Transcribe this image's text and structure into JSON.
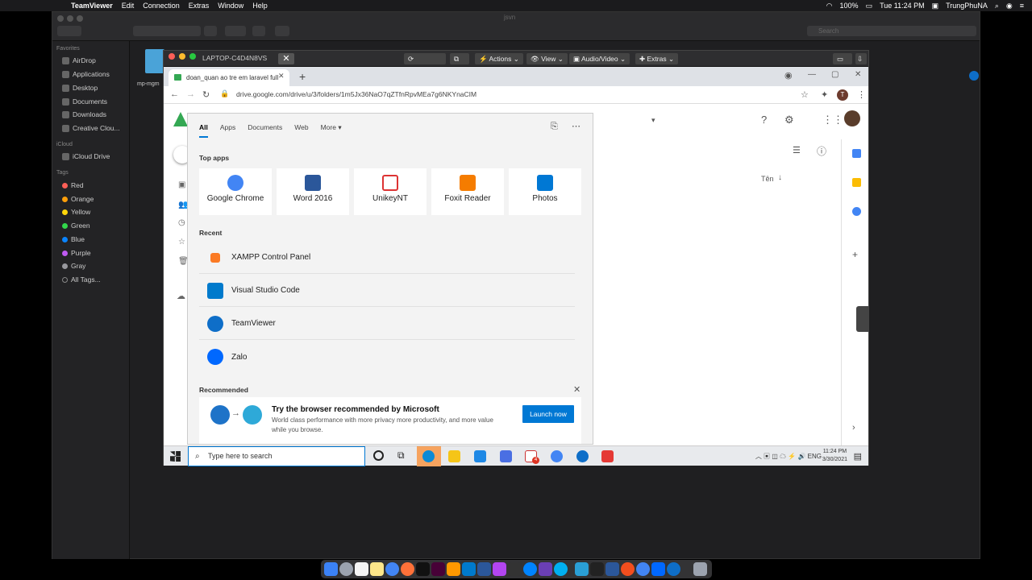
{
  "mac_menubar": {
    "app_name": "TeamViewer",
    "menus": [
      "Edit",
      "Connection",
      "Extras",
      "Window",
      "Help"
    ],
    "battery": "100%",
    "clock": "Tue 11:24 PM",
    "user": "TrungPhuNA"
  },
  "finder": {
    "title": "jsvn",
    "search_placeholder": "Search",
    "favorites_label": "Favorites",
    "favorites": [
      "AirDrop",
      "Applications",
      "Desktop",
      "Documents",
      "Downloads",
      "Creative Clou..."
    ],
    "icloud_label": "iCloud",
    "icloud_items": [
      "iCloud Drive"
    ],
    "tags_label": "Tags",
    "tags": [
      {
        "name": "Red",
        "color": "#ff5f57"
      },
      {
        "name": "Orange",
        "color": "#ff9f0a"
      },
      {
        "name": "Yellow",
        "color": "#ffd60a"
      },
      {
        "name": "Green",
        "color": "#32d74b"
      },
      {
        "name": "Blue",
        "color": "#0a84ff"
      },
      {
        "name": "Purple",
        "color": "#bf5af2"
      },
      {
        "name": "Gray",
        "color": "#98989d"
      }
    ],
    "all_tags": "All Tags...",
    "folder_label": "mp-mgm"
  },
  "teamviewer": {
    "machine_name": "LAPTOP-C4D4N8VS",
    "toolbar": {
      "actions": "Actions",
      "view": "View",
      "audio_video": "Audio/Video",
      "extras": "Extras"
    }
  },
  "chrome": {
    "tab_title": "doan_quan ao tre em laravel full",
    "url": "drive.google.com/drive/u/3/folders/1m5Jx36NaO7qZTfnRpvMEa7g6NKYnaCIM",
    "profile_initial": "T"
  },
  "drive": {
    "sort_label": "Tên"
  },
  "start_menu": {
    "tabs": [
      "All",
      "Apps",
      "Documents",
      "Web",
      "More"
    ],
    "top_apps_label": "Top apps",
    "top_apps": [
      {
        "name": "Google Chrome",
        "color": "#4285f4"
      },
      {
        "name": "Word 2016",
        "color": "#2b579a"
      },
      {
        "name": "UnikeyNT",
        "color": "#d33"
      },
      {
        "name": "Foxit Reader",
        "color": "#f57c00"
      },
      {
        "name": "Photos",
        "color": "#0078d4"
      }
    ],
    "recent_label": "Recent",
    "recent": [
      {
        "name": "XAMPP Control Panel",
        "color": "#fb7a24"
      },
      {
        "name": "Visual Studio Code",
        "color": "#007acc"
      },
      {
        "name": "TeamViewer",
        "color": "#0e6ec8"
      },
      {
        "name": "Zalo",
        "color": "#0068ff"
      }
    ],
    "recommended_label": "Recommended",
    "recommended": {
      "title": "Try the browser recommended by Microsoft",
      "description": "World class performance with more privacy more productivity, and more value while you browse.",
      "button": "Launch now"
    }
  },
  "taskbar": {
    "search_placeholder": "Type here to search",
    "lang": "ENG",
    "time": "11:24 PM",
    "date": "3/30/2021",
    "badge": "4"
  }
}
